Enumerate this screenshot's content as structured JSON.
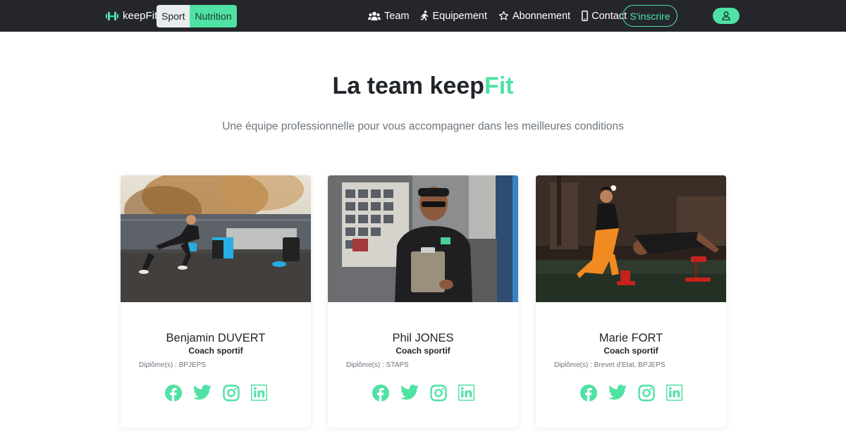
{
  "nav": {
    "brand": "keepFit",
    "segment": {
      "sport": "Sport",
      "nutrition": "Nutrition",
      "active": "Nutrition"
    },
    "links": [
      {
        "label": "Team",
        "icon": "users-icon"
      },
      {
        "label": "Equipement",
        "icon": "running-icon"
      },
      {
        "label": "Abonnement",
        "icon": "star-icon"
      },
      {
        "label": "Contact",
        "icon": "phone-icon"
      }
    ],
    "signup_label": "S'inscrire",
    "user_icon": "user-icon"
  },
  "hero": {
    "title_main": "La team keep",
    "title_accent": "Fit",
    "subtitle": "Une équipe professionnelle pour vous accompagner dans les meilleures conditions"
  },
  "team": [
    {
      "name": "Benjamin DUVERT",
      "role": "Coach sportif",
      "diploma": "Diplôme(s) : BPJEPS"
    },
    {
      "name": "Phil JONES",
      "role": "Coach sportif",
      "diploma": "Diplôme(s) : STAPS"
    },
    {
      "name": "Marie FORT",
      "role": "Coach sportif",
      "diploma": "Diplôme(s) : Brevet d'Etat, BPJEPS"
    }
  ],
  "socials": [
    "facebook-icon",
    "twitter-icon",
    "instagram-icon",
    "linkedin-icon"
  ],
  "colors": {
    "accent": "#4fe2a4",
    "navbar": "#24262b",
    "text": "#212529",
    "muted": "#6c757d"
  }
}
